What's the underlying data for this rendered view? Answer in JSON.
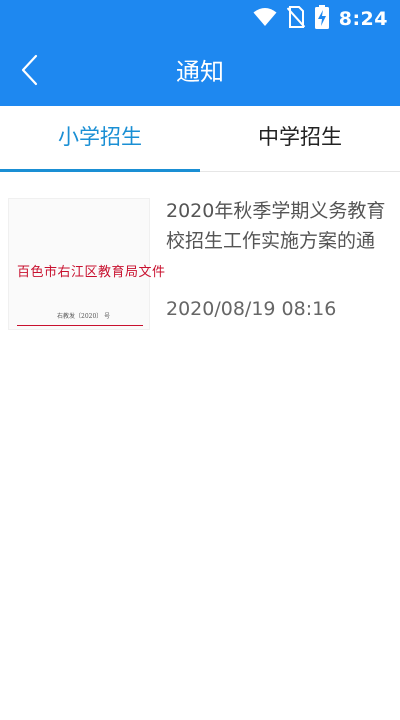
{
  "status_bar": {
    "time": "8:24",
    "icons": [
      "wifi-icon",
      "no-sim-icon",
      "battery-charging-icon"
    ]
  },
  "app_bar": {
    "title": "通知",
    "back_icon": "chevron-left-icon"
  },
  "tabs": [
    {
      "label": "小学招生",
      "active": true
    },
    {
      "label": "中学招生",
      "active": false
    }
  ],
  "notices": [
    {
      "title_line1": "2020年秋季学期义务教育",
      "title_line2": "校招生工作实施方案的通",
      "date": "2020/08/19 08:16",
      "thumbnail": {
        "heading": "百色市右江区教育局文件",
        "doc_no": "右教发〔2020〕  号"
      }
    }
  ],
  "colors": {
    "header": "#1e88f0",
    "tab_active": "#1a8fd4",
    "document_red": "#c8102e"
  }
}
